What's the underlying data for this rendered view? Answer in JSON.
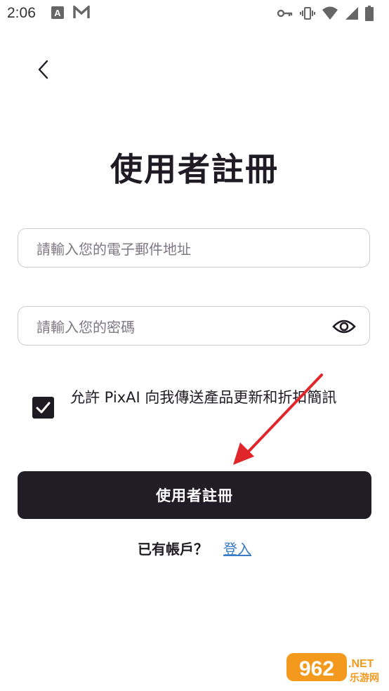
{
  "status_bar": {
    "time": "2:06",
    "left_icons": [
      "a-box-icon",
      "m-mail-icon"
    ],
    "right_icons": [
      "key-icon",
      "vibrate-icon",
      "wifi-icon",
      "signal-icon",
      "battery-icon"
    ]
  },
  "nav": {
    "back_icon": "chevron-left-icon"
  },
  "page": {
    "title": "使用者註冊"
  },
  "form": {
    "email": {
      "value": "",
      "placeholder": "請輸入您的電子郵件地址"
    },
    "password": {
      "value": "",
      "placeholder": "請輸入您的密碼",
      "toggle_icon": "eye-icon"
    },
    "consent": {
      "checked": true,
      "label": "允許 PixAI 向我傳送產品更新和折扣簡訊"
    },
    "submit_label": "使用者註冊"
  },
  "footer": {
    "question": "已有帳戶？",
    "login_link": "登入"
  },
  "watermark": {
    "number": "962",
    "suffix": ".NET",
    "sub": "乐游网"
  },
  "colors": {
    "primary": "#211d27",
    "link": "#3b7bc4",
    "border": "#cfcbd4",
    "arrow": "#e0262a"
  }
}
